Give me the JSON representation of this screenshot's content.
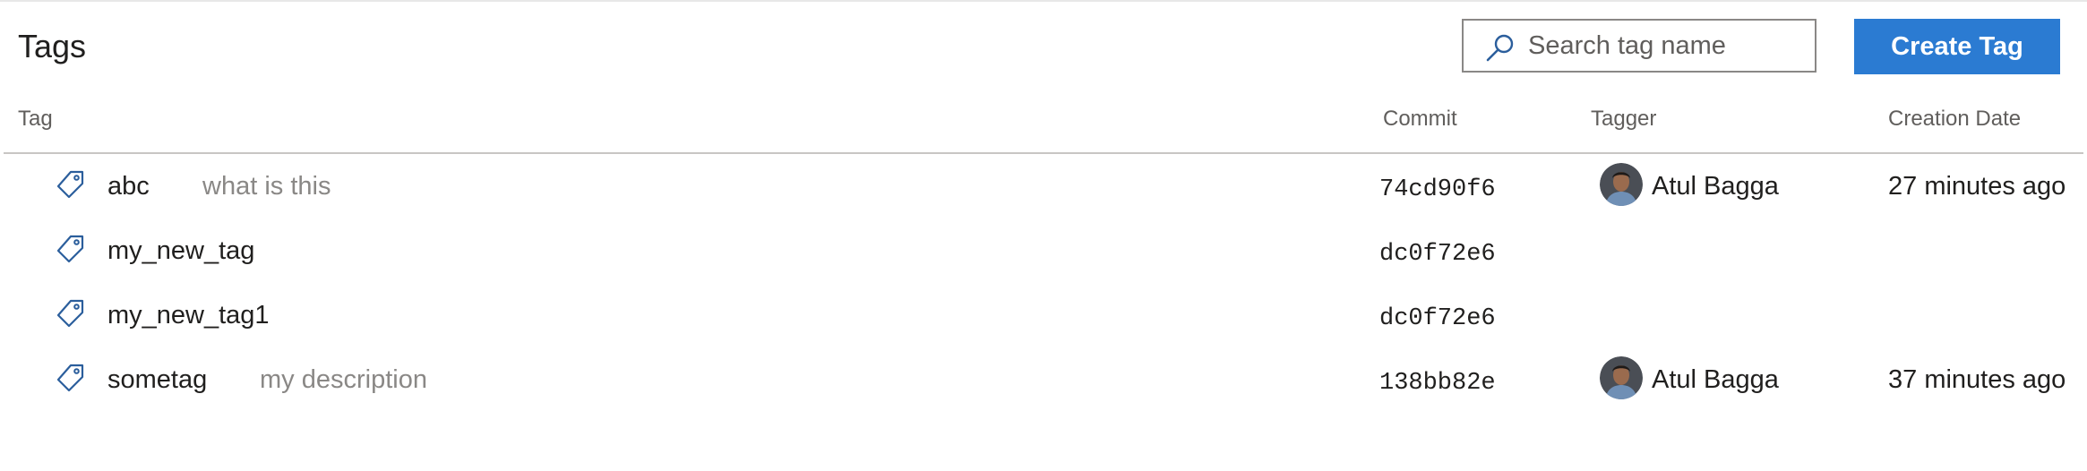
{
  "header": {
    "title": "Tags",
    "search": {
      "placeholder": "Search tag name",
      "value": "",
      "icon": "search-icon"
    },
    "create_button_label": "Create Tag"
  },
  "columns": {
    "tag": "Tag",
    "commit": "Commit",
    "tagger": "Tagger",
    "creation_date": "Creation Date"
  },
  "rows": [
    {
      "name": "abc",
      "description": "what is this",
      "commit": "74cd90f6",
      "tagger": "Atul Bagga",
      "creation_date": "27 minutes ago"
    },
    {
      "name": "my_new_tag",
      "description": "",
      "commit": "dc0f72e6",
      "tagger": "",
      "creation_date": ""
    },
    {
      "name": "my_new_tag1",
      "description": "",
      "commit": "dc0f72e6",
      "tagger": "",
      "creation_date": ""
    },
    {
      "name": "sometag",
      "description": "my description",
      "commit": "138bb82e",
      "tagger": "Atul Bagga",
      "creation_date": "37 minutes ago"
    }
  ],
  "colors": {
    "accent": "#2b7bd2",
    "icon": "#2b5e9c",
    "secondary_text": "#8a8886"
  },
  "icons": {
    "row": "tag-icon",
    "avatar": "avatar-icon"
  }
}
